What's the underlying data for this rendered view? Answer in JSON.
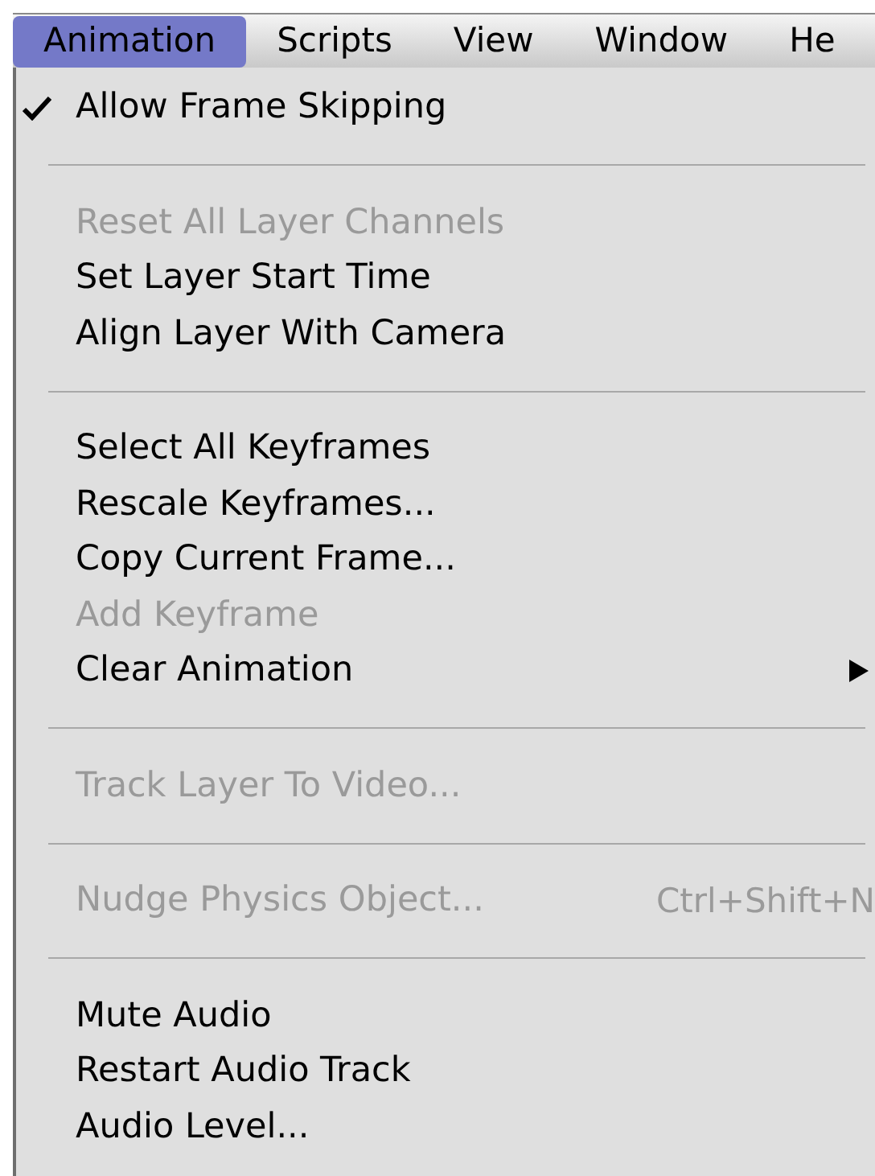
{
  "menu_bar": [
    {
      "label": "Animation",
      "selected": true
    },
    {
      "label": "Scripts",
      "selected": false
    },
    {
      "label": "View",
      "selected": false
    },
    {
      "label": "Window",
      "selected": false
    },
    {
      "label": "He",
      "selected": false
    }
  ],
  "menu": {
    "sections": [
      {
        "items": [
          {
            "label": "Allow Frame Skipping",
            "checked": true,
            "disabled": false,
            "has_submenu": false
          }
        ]
      },
      {
        "items": [
          {
            "label": "Reset All Layer Channels",
            "checked": false,
            "disabled": true,
            "has_submenu": false
          },
          {
            "label": "Set Layer Start Time",
            "checked": false,
            "disabled": false,
            "has_submenu": false
          },
          {
            "label": "Align Layer With Camera",
            "checked": false,
            "disabled": false,
            "has_submenu": false
          }
        ]
      },
      {
        "items": [
          {
            "label": "Select All Keyframes",
            "checked": false,
            "disabled": false,
            "has_submenu": false
          },
          {
            "label": "Rescale Keyframes...",
            "checked": false,
            "disabled": false,
            "has_submenu": false
          },
          {
            "label": "Copy Current Frame...",
            "checked": false,
            "disabled": false,
            "has_submenu": false
          },
          {
            "label": "Add Keyframe",
            "checked": false,
            "disabled": true,
            "has_submenu": false
          },
          {
            "label": "Clear Animation",
            "checked": false,
            "disabled": false,
            "has_submenu": true
          }
        ]
      },
      {
        "items": [
          {
            "label": "Track Layer To Video...",
            "checked": false,
            "disabled": true,
            "has_submenu": false
          }
        ]
      },
      {
        "items": [
          {
            "label": "Nudge Physics Object...",
            "shortcut": "Ctrl+Shift+N",
            "checked": false,
            "disabled": true,
            "has_submenu": false
          }
        ]
      },
      {
        "items": [
          {
            "label": "Mute Audio",
            "checked": false,
            "disabled": false,
            "has_submenu": false
          },
          {
            "label": "Restart Audio Track",
            "checked": false,
            "disabled": false,
            "has_submenu": false
          },
          {
            "label": "Audio Level...",
            "checked": false,
            "disabled": false,
            "has_submenu": false
          }
        ]
      }
    ]
  }
}
